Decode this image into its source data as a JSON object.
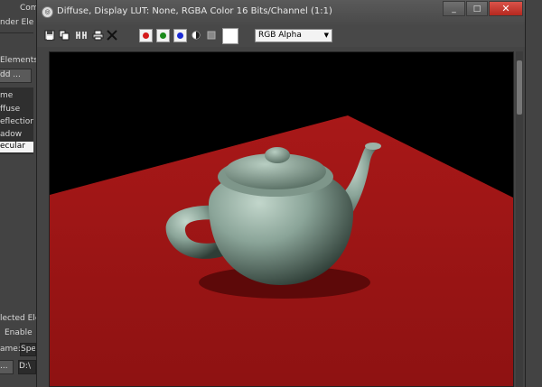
{
  "background": {
    "labels": [
      "Com",
      "nder Ele",
      "Elements",
      "dd ...",
      "lected Ele",
      "Enable",
      "ame:",
      "Spe",
      "...",
      "D:\\"
    ],
    "list_items": [
      "me",
      "ffuse",
      "eflection",
      "adow",
      "ecular"
    ],
    "selected_index": 4
  },
  "window": {
    "title": "Diffuse, Display LUT: None, RGBA Color 16 Bits/Channel (1:1)",
    "controls": {
      "minimize": "_",
      "restore": "□",
      "close": "✕"
    }
  },
  "toolbar": {
    "icons": [
      "save-icon",
      "copy-icon",
      "clone-icon",
      "print-icon",
      "clear-icon"
    ],
    "channel_colors": {
      "red": "#d41a1a",
      "green": "#1a8a1a",
      "blue": "#1a2ad4"
    },
    "swatch_color": "#ffffff",
    "display_channel": "RGB Alpha"
  },
  "render": {
    "background_color": "#000000",
    "floor_color": "#9e1616",
    "object_color": "#7f9a8d"
  }
}
